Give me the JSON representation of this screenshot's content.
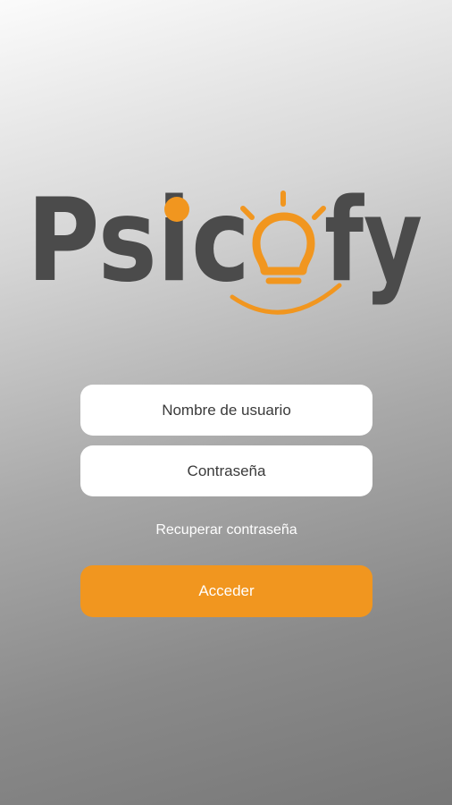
{
  "brand": {
    "name": "Psicofy",
    "letters_left": "Psic",
    "letters_right": "fy",
    "text_color": "#4b4b4b",
    "accent_color": "#f1961f"
  },
  "login": {
    "username_placeholder": "Nombre de usuario",
    "password_placeholder": "Contraseña",
    "recover_link": "Recuperar contraseña",
    "submit_label": "Acceder"
  },
  "colors": {
    "field_bg": "#ffffff",
    "button_bg": "#f1961f",
    "link_text": "#ffffff"
  }
}
